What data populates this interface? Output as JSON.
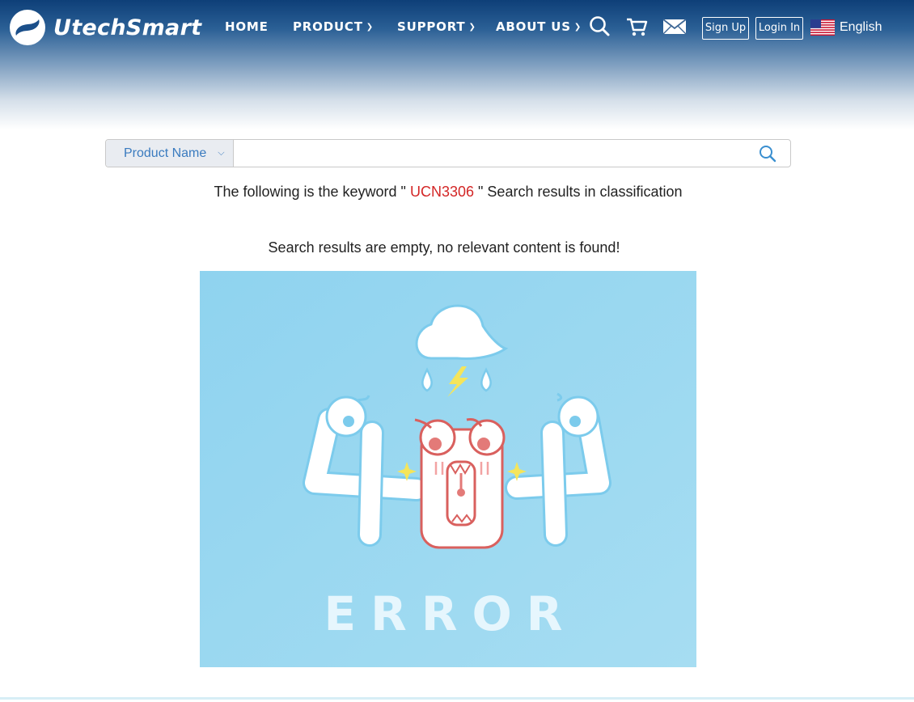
{
  "header": {
    "brand": "UtechSmart",
    "nav": [
      {
        "label": "HOME",
        "dropdown": false
      },
      {
        "label": "PRODUCT",
        "dropdown": true
      },
      {
        "label": "SUPPORT",
        "dropdown": true
      },
      {
        "label": "ABOUT US",
        "dropdown": true
      }
    ],
    "icons": [
      "search-icon",
      "cart-icon",
      "mail-icon"
    ],
    "signup_label": "Sign Up",
    "login_label": "Login In",
    "language": "English"
  },
  "search": {
    "category": "Product Name",
    "value": "",
    "placeholder": ""
  },
  "results": {
    "prefix": "The following is the keyword \"",
    "keyword": "UCN3306",
    "suffix": "\" Search results in classification",
    "empty_message": "Search results are empty, no relevant content is found!"
  },
  "error_image": {
    "caption": "ERROR"
  },
  "colors": {
    "header_top": "#0e3f78",
    "accent_blue": "#3a7bbf",
    "keyword_red": "#d32626",
    "art_background": "#8fd3ef"
  }
}
